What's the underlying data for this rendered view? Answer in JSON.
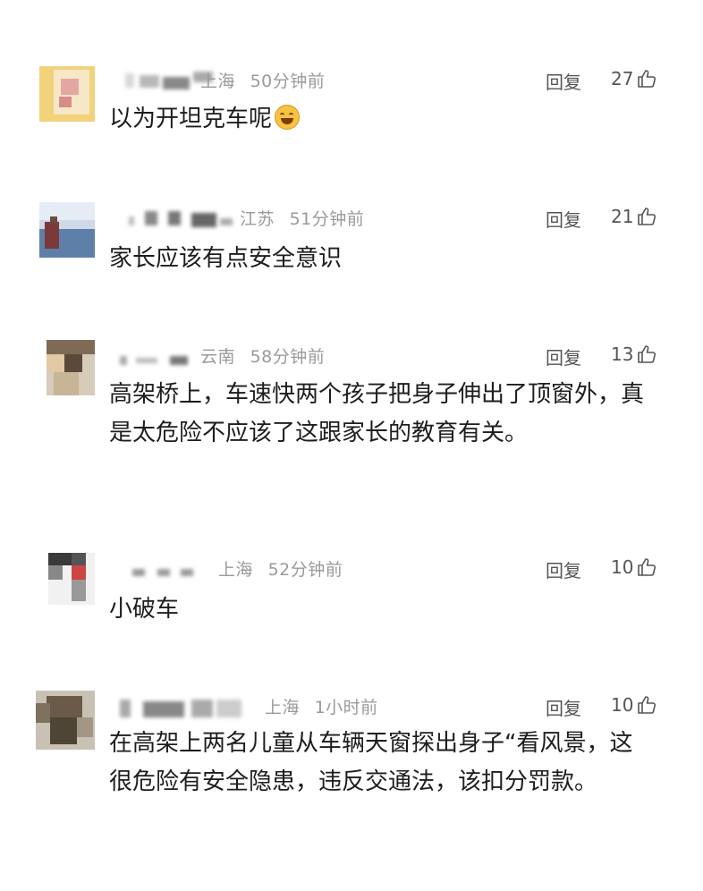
{
  "comments": [
    {
      "location": "上海",
      "time": "50分钟前",
      "reply_label": "回复",
      "likes": "27",
      "text": "以为开坦克车呢",
      "emoji": "laughing-tears"
    },
    {
      "location": "江苏",
      "time": "51分钟前",
      "reply_label": "回复",
      "likes": "21",
      "text": "家长应该有点安全意识"
    },
    {
      "location": "云南",
      "time": "58分钟前",
      "reply_label": "回复",
      "likes": "13",
      "text": "高架桥上，车速快两个孩子把身子伸出了顶窗外，真是太危险不应该了这跟家长的教育有关。"
    },
    {
      "location": "上海",
      "time": "52分钟前",
      "reply_label": "回复",
      "likes": "10",
      "text": "小破车"
    },
    {
      "location": "上海",
      "time": "1小时前",
      "reply_label": "回复",
      "likes": "10",
      "text": "在高架上两名儿童从车辆天窗探出身子“看风景，这很危险有安全隐患，违反交通法，该扣分罚款。"
    }
  ],
  "colors": {
    "text": "#1d1d1d",
    "meta": "#9a9a9a",
    "action": "#555555"
  },
  "icons": {
    "like": "thumbs-up-icon",
    "emoji": "laughing-emoji-icon"
  }
}
